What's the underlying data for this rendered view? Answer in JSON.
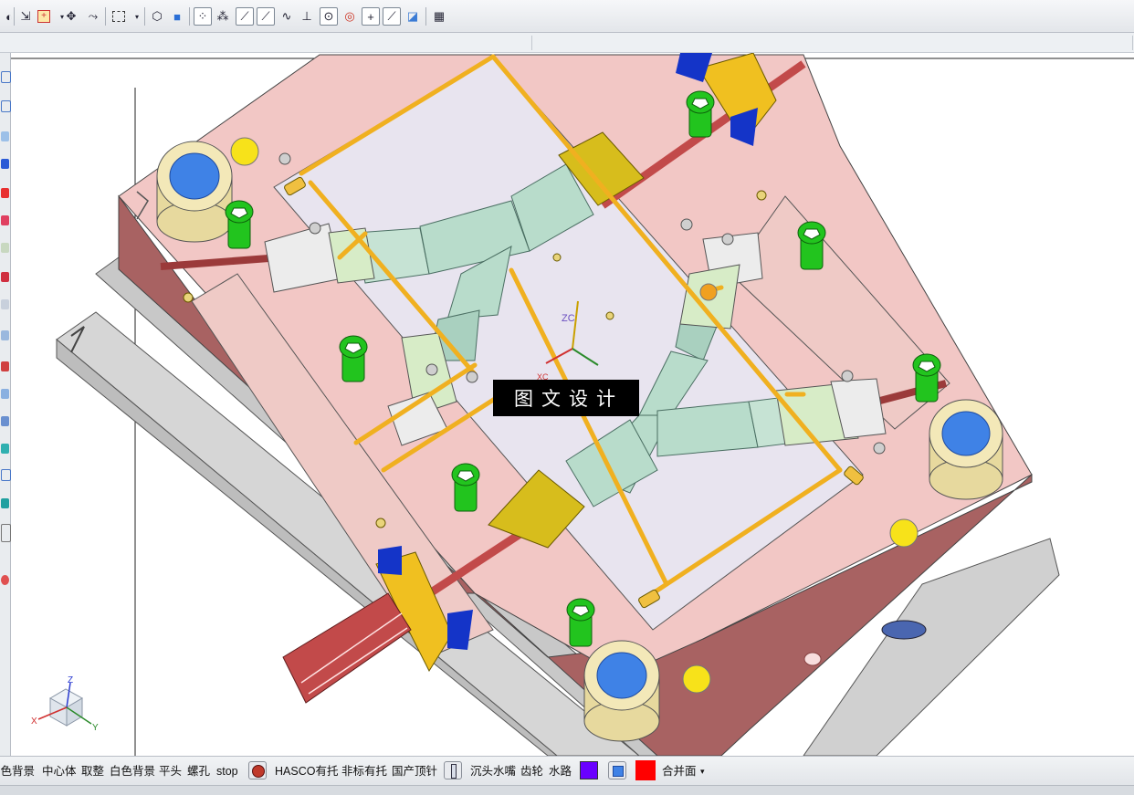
{
  "watermark": {
    "text": "图文设计"
  },
  "axes": {
    "zc_label": "ZC",
    "xc_label": "XC",
    "triad_z": "Z",
    "triad_x": "X",
    "triad_y": "Y"
  },
  "bottom_toolbar": {
    "items": [
      {
        "label": "黑色背景",
        "kind": "text"
      },
      {
        "label": "中心体",
        "kind": "text"
      },
      {
        "label": "取整",
        "kind": "text"
      },
      {
        "label": "白色背景",
        "kind": "text"
      },
      {
        "label": "平头",
        "kind": "text"
      },
      {
        "label": "螺孔",
        "kind": "text"
      },
      {
        "label": "stop",
        "kind": "text"
      },
      {
        "icon": "stop-circle-icon",
        "kind": "icon"
      },
      {
        "label": "HASCO有托",
        "kind": "text"
      },
      {
        "label": "非标有托",
        "kind": "text"
      },
      {
        "label": "国产顶针",
        "kind": "text"
      },
      {
        "icon": "ejector-pin-icon",
        "kind": "icon"
      },
      {
        "label": "沉头水嘴",
        "kind": "text"
      },
      {
        "label": "齿轮",
        "kind": "text"
      },
      {
        "label": "水路",
        "kind": "text"
      },
      {
        "icon": "purple-color-swatch-icon",
        "kind": "icon",
        "color": "#6a00ff"
      },
      {
        "icon": "cube-view-icon",
        "kind": "icon"
      },
      {
        "icon": "red-color-swatch-icon",
        "kind": "icon",
        "color": "#ff0000"
      },
      {
        "label": "合并面",
        "kind": "text"
      }
    ]
  },
  "colors": {
    "plate_pink": "#f2c7c5",
    "plate_side": "#9a5b5b",
    "base_gray": "#cfcfcf",
    "water_line": "#f0b020",
    "runner": "#b8dccb",
    "slider": "#d7ecc7",
    "bolt_green": "#22c41e",
    "guide_bush": "#f3e8b8",
    "guide_hole": "#3f82e6",
    "block_yellow": "#e3c400",
    "cylinder_red": "#c24a4a",
    "accent_blue": "#1434c8"
  }
}
